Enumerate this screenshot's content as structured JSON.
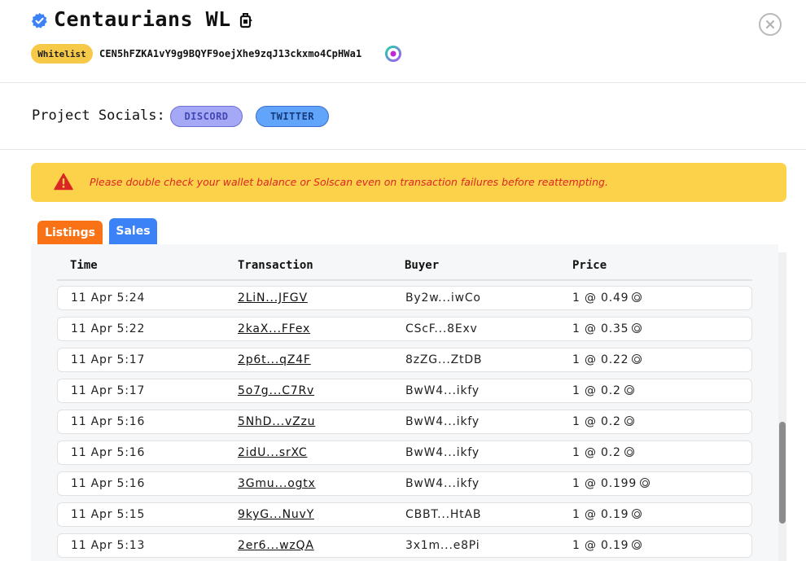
{
  "header": {
    "title": "Centaurians WL",
    "badge": "Whitelist",
    "address": "CEN5hFZKA1vY9g9BQYF9oejXhe9zqJ13ckxmo4CpHWa1"
  },
  "socials": {
    "label": "Project Socials:",
    "discord_label": "DISCORD",
    "twitter_label": "TWITTER"
  },
  "alert": {
    "text": "Please double check your wallet balance or Solscan even on transaction failures before reattempting."
  },
  "tabs": [
    {
      "label": "Listings",
      "active": false
    },
    {
      "label": "Sales",
      "active": true
    }
  ],
  "table": {
    "headers": [
      "Time",
      "Transaction",
      "Buyer",
      "Price"
    ],
    "rows": [
      {
        "time": "11 Apr 5:24",
        "tx": "2LiN...JFGV",
        "buyer": "By2w...iwCo",
        "price": "1 @ 0.49"
      },
      {
        "time": "11 Apr 5:22",
        "tx": "2kaX...FFex",
        "buyer": "CScF...8Exv",
        "price": "1 @ 0.35"
      },
      {
        "time": "11 Apr 5:17",
        "tx": "2p6t...qZ4F",
        "buyer": "8zZG...ZtDB",
        "price": "1 @ 0.22"
      },
      {
        "time": "11 Apr 5:17",
        "tx": "5o7g...C7Rv",
        "buyer": "BwW4...ikfy",
        "price": "1 @ 0.2"
      },
      {
        "time": "11 Apr 5:16",
        "tx": "5NhD...vZzu",
        "buyer": "BwW4...ikfy",
        "price": "1 @ 0.2"
      },
      {
        "time": "11 Apr 5:16",
        "tx": "2idU...srXC",
        "buyer": "BwW4...ikfy",
        "price": "1 @ 0.2"
      },
      {
        "time": "11 Apr 5:16",
        "tx": "3Gmu...ogtx",
        "buyer": "BwW4...ikfy",
        "price": "1 @ 0.199"
      },
      {
        "time": "11 Apr 5:15",
        "tx": "9kyG...NuvY",
        "buyer": "CBBT...HtAB",
        "price": "1 @ 0.19"
      },
      {
        "time": "11 Apr 5:13",
        "tx": "2er6...wzQA",
        "buyer": "3x1m...e8Pi",
        "price": "1 @ 0.19"
      }
    ]
  },
  "icons": {
    "verified": "verified-check-icon",
    "title_badge": "pass-icon",
    "close": "close-icon",
    "address_logo": "magic-eden-logo-icon",
    "alert": "warning-triangle-icon",
    "currency": "sol-icon"
  },
  "colors": {
    "badge": "#f7c948",
    "discord": "#a5a8f4",
    "twitter": "#60a5fa",
    "alert_bg": "#fbd24a",
    "alert_text": "#dc2626",
    "tab_listings": "#f97316",
    "tab_sales": "#3b82f6"
  }
}
